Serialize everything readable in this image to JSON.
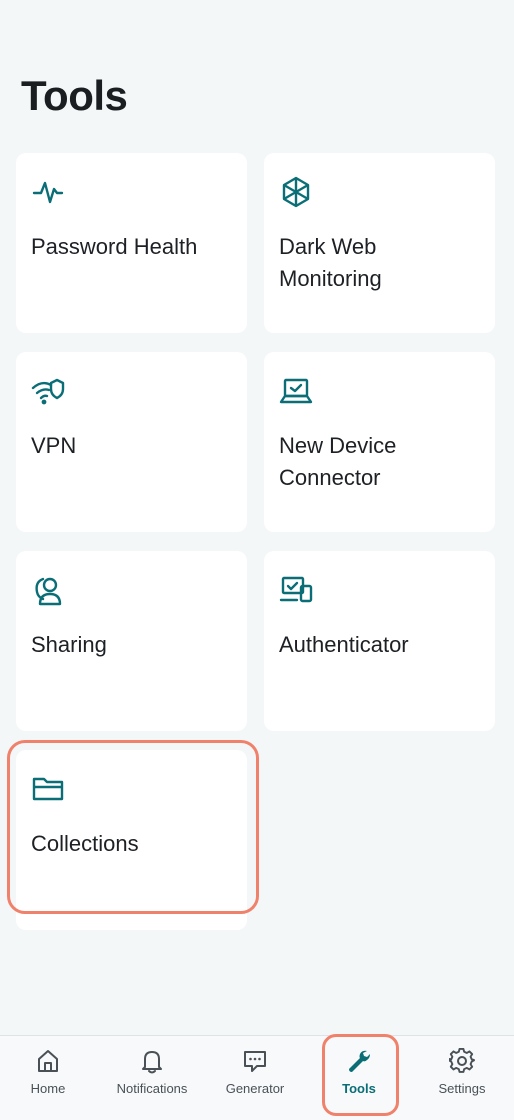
{
  "page": {
    "title": "Tools"
  },
  "cards": [
    {
      "label": "Password Health",
      "icon": "pulse-icon"
    },
    {
      "label": "Dark Web Monitoring",
      "icon": "shield-cube-icon"
    },
    {
      "label": "VPN",
      "icon": "wifi-shield-icon"
    },
    {
      "label": "New Device Connector",
      "icon": "laptop-check-icon"
    },
    {
      "label": "Sharing",
      "icon": "user-share-icon"
    },
    {
      "label": "Authenticator",
      "icon": "devices-check-icon"
    },
    {
      "label": "Collections",
      "icon": "folder-icon"
    }
  ],
  "tabbar": {
    "items": [
      {
        "label": "Home",
        "icon": "home-icon",
        "active": false
      },
      {
        "label": "Notifications",
        "icon": "bell-icon",
        "active": false
      },
      {
        "label": "Generator",
        "icon": "chat-icon",
        "active": false
      },
      {
        "label": "Tools",
        "icon": "wrench-icon",
        "active": true
      },
      {
        "label": "Settings",
        "icon": "gear-icon",
        "active": false
      }
    ]
  },
  "colors": {
    "accent": "#0b6e77",
    "highlight": "#f0816b",
    "background": "#f4f7f8",
    "card": "#ffffff"
  }
}
